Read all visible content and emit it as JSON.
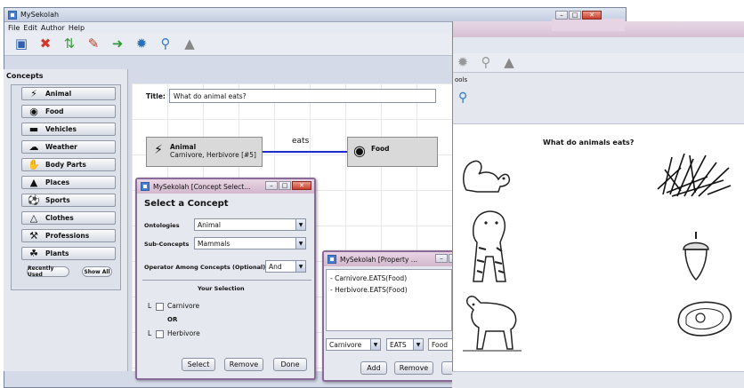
{
  "main_window": {
    "title": "MySekolah",
    "menu": [
      "File",
      "Edit",
      "Author",
      "Help"
    ]
  },
  "toolbar_icons": [
    "save-icon",
    "cancel-icon",
    "shuffle-icon",
    "edit-icon",
    "arrow-icon",
    "wheel-icon",
    "search-icon",
    "shape-icon"
  ],
  "concepts": {
    "title": "Concepts",
    "items": [
      "Animal",
      "Food",
      "Vehicles",
      "Weather",
      "Body Parts",
      "Places",
      "Sports",
      "Clothes",
      "Professions",
      "Plants"
    ],
    "recently_used": "Recently Used",
    "show_all": "Show All"
  },
  "canvas": {
    "title_label": "Title:",
    "title_value": "What do animal eats?",
    "node_animal_label": "Animal",
    "node_animal_sub": "Carnivore, Herbivore [#5]",
    "edge_label": "eats",
    "node_food_label": "Food"
  },
  "concept_dialog": {
    "title": "MySekolah [Concept Select...",
    "heading": "Select a Concept",
    "ontologies_label": "Ontologies",
    "ontologies_value": "Animal",
    "subconcepts_label": "Sub-Concepts",
    "subconcepts_value": "Mammals",
    "operator_label": "Operator Among Concepts (Optional)",
    "operator_value": "And",
    "your_selection": "Your Selection",
    "sel1_prefix": "L",
    "sel1": "Carnivore",
    "or": "OR",
    "sel2_prefix": "L",
    "sel2": "Herbivore",
    "select_btn": "Select",
    "remove_btn": "Remove",
    "done_btn": "Done"
  },
  "property_dialog": {
    "title": "MySekolah [Property ...",
    "list": [
      "- Carnivore.EATS(Food)",
      "- Herbivore.EATS(Food)"
    ],
    "combo1": "Carnivore",
    "combo2": "EATS",
    "combo3": "Food",
    "add_btn": "Add",
    "remove_btn": "Remove"
  },
  "right_window": {
    "tools_label": "ools",
    "heading": "What do animals eats?"
  }
}
